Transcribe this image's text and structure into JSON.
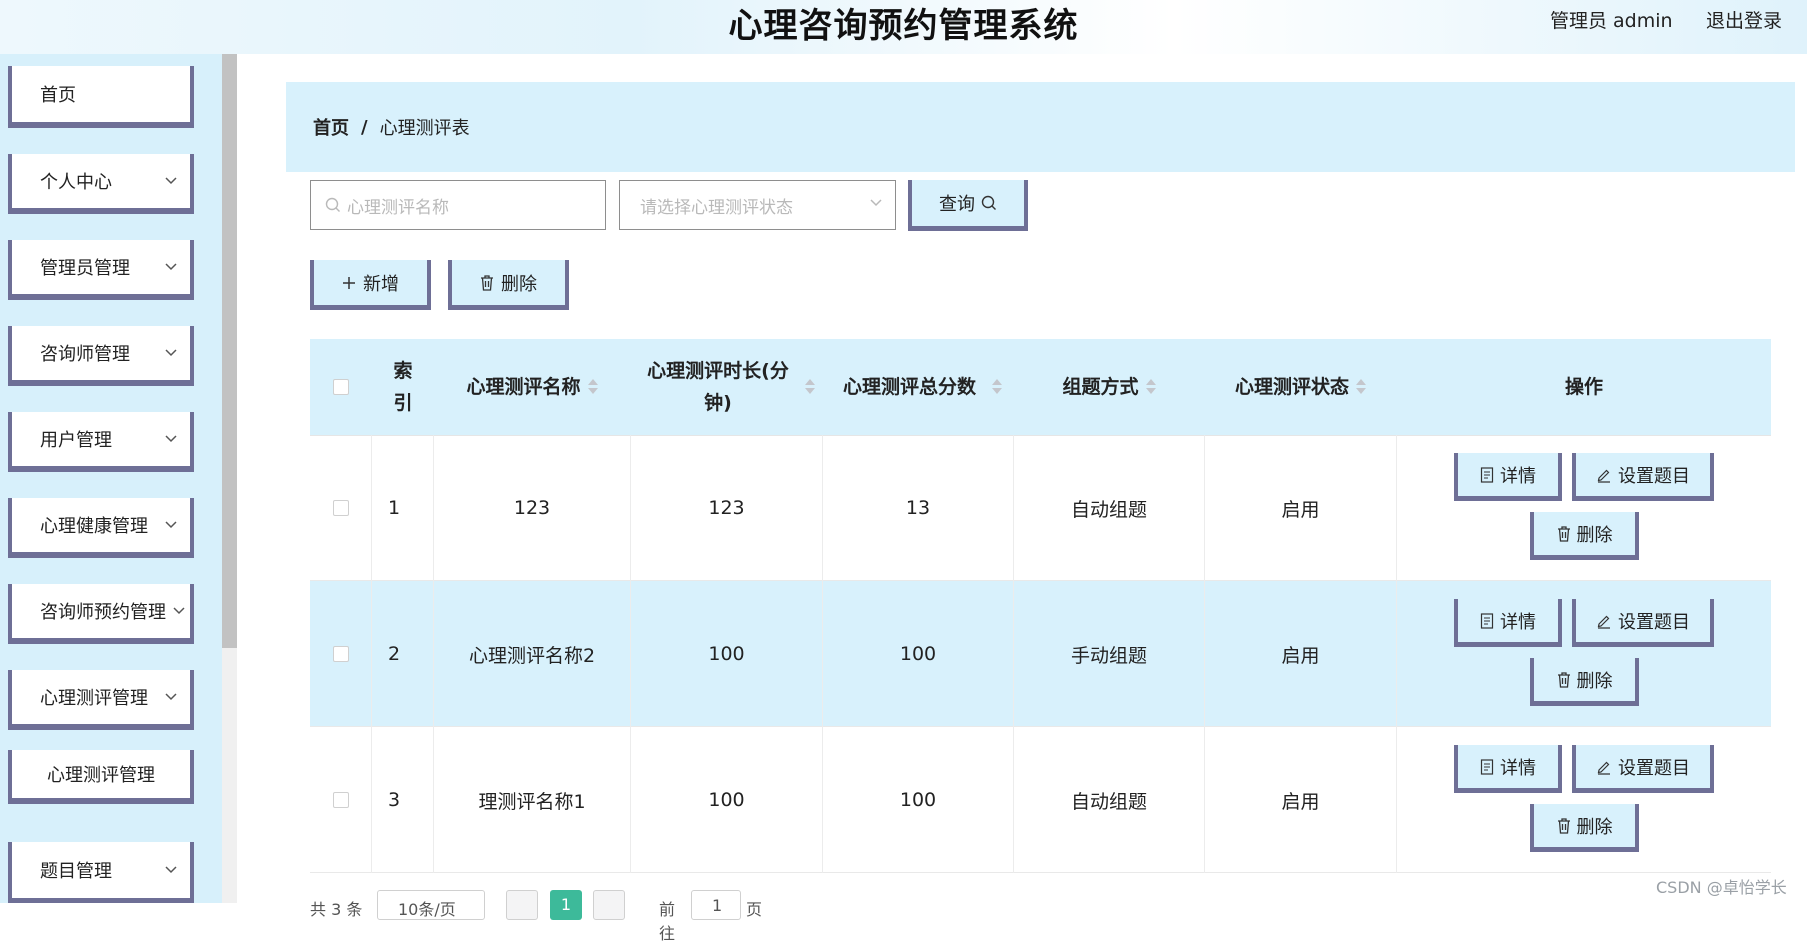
{
  "header": {
    "title": "心理咨询预约管理系统",
    "user": "管理员 admin",
    "logout": "退出登录"
  },
  "sidebar": {
    "items": [
      {
        "label": "首页"
      },
      {
        "label": "个人中心"
      },
      {
        "label": "管理员管理"
      },
      {
        "label": "咨询师管理"
      },
      {
        "label": "用户管理"
      },
      {
        "label": "心理健康管理"
      },
      {
        "label": "咨询师预约管理"
      },
      {
        "label": "心理测评管理"
      },
      {
        "label": "心理测评管理"
      },
      {
        "label": "题目管理"
      }
    ]
  },
  "breadcrumb": {
    "home": "首页",
    "separator": "/",
    "current": "心理测评表"
  },
  "search": {
    "name_placeholder": "心理测评名称",
    "status_placeholder": "请选择心理测评状态",
    "query_label": "查询"
  },
  "toolbar": {
    "add_label": "新增",
    "delete_label": "删除"
  },
  "table": {
    "columns": [
      {
        "label": "索引"
      },
      {
        "label": "心理测评名称"
      },
      {
        "label": "心理测评时长(分钟)"
      },
      {
        "label": "心理测评总分数"
      },
      {
        "label": "组题方式"
      },
      {
        "label": "心理测评状态"
      },
      {
        "label": "操作"
      }
    ],
    "rows": [
      {
        "index": "1",
        "name": "123",
        "duration": "123",
        "score": "13",
        "mode": "自动组题",
        "status": "启用"
      },
      {
        "index": "2",
        "name": "心理测评名称2",
        "duration": "100",
        "score": "100",
        "mode": "手动组题",
        "status": "启用"
      },
      {
        "index": "3",
        "name": "理测评名称1",
        "duration": "100",
        "score": "100",
        "mode": "自动组题",
        "status": "启用"
      }
    ],
    "actions": {
      "detail": "详情",
      "setup": "设置题目",
      "delete": "删除"
    }
  },
  "pager": {
    "total": "共 3 条",
    "page_size": "10条/页",
    "current_page": "1",
    "goto_prefix": "前往",
    "goto_value": "1",
    "goto_suffix": "页"
  },
  "watermark": "CSDN @卓怡学长",
  "colors": {
    "accent_light": "#d8f1fc",
    "border_dark": "#6e6f96",
    "page_active": "#3dba9a"
  }
}
